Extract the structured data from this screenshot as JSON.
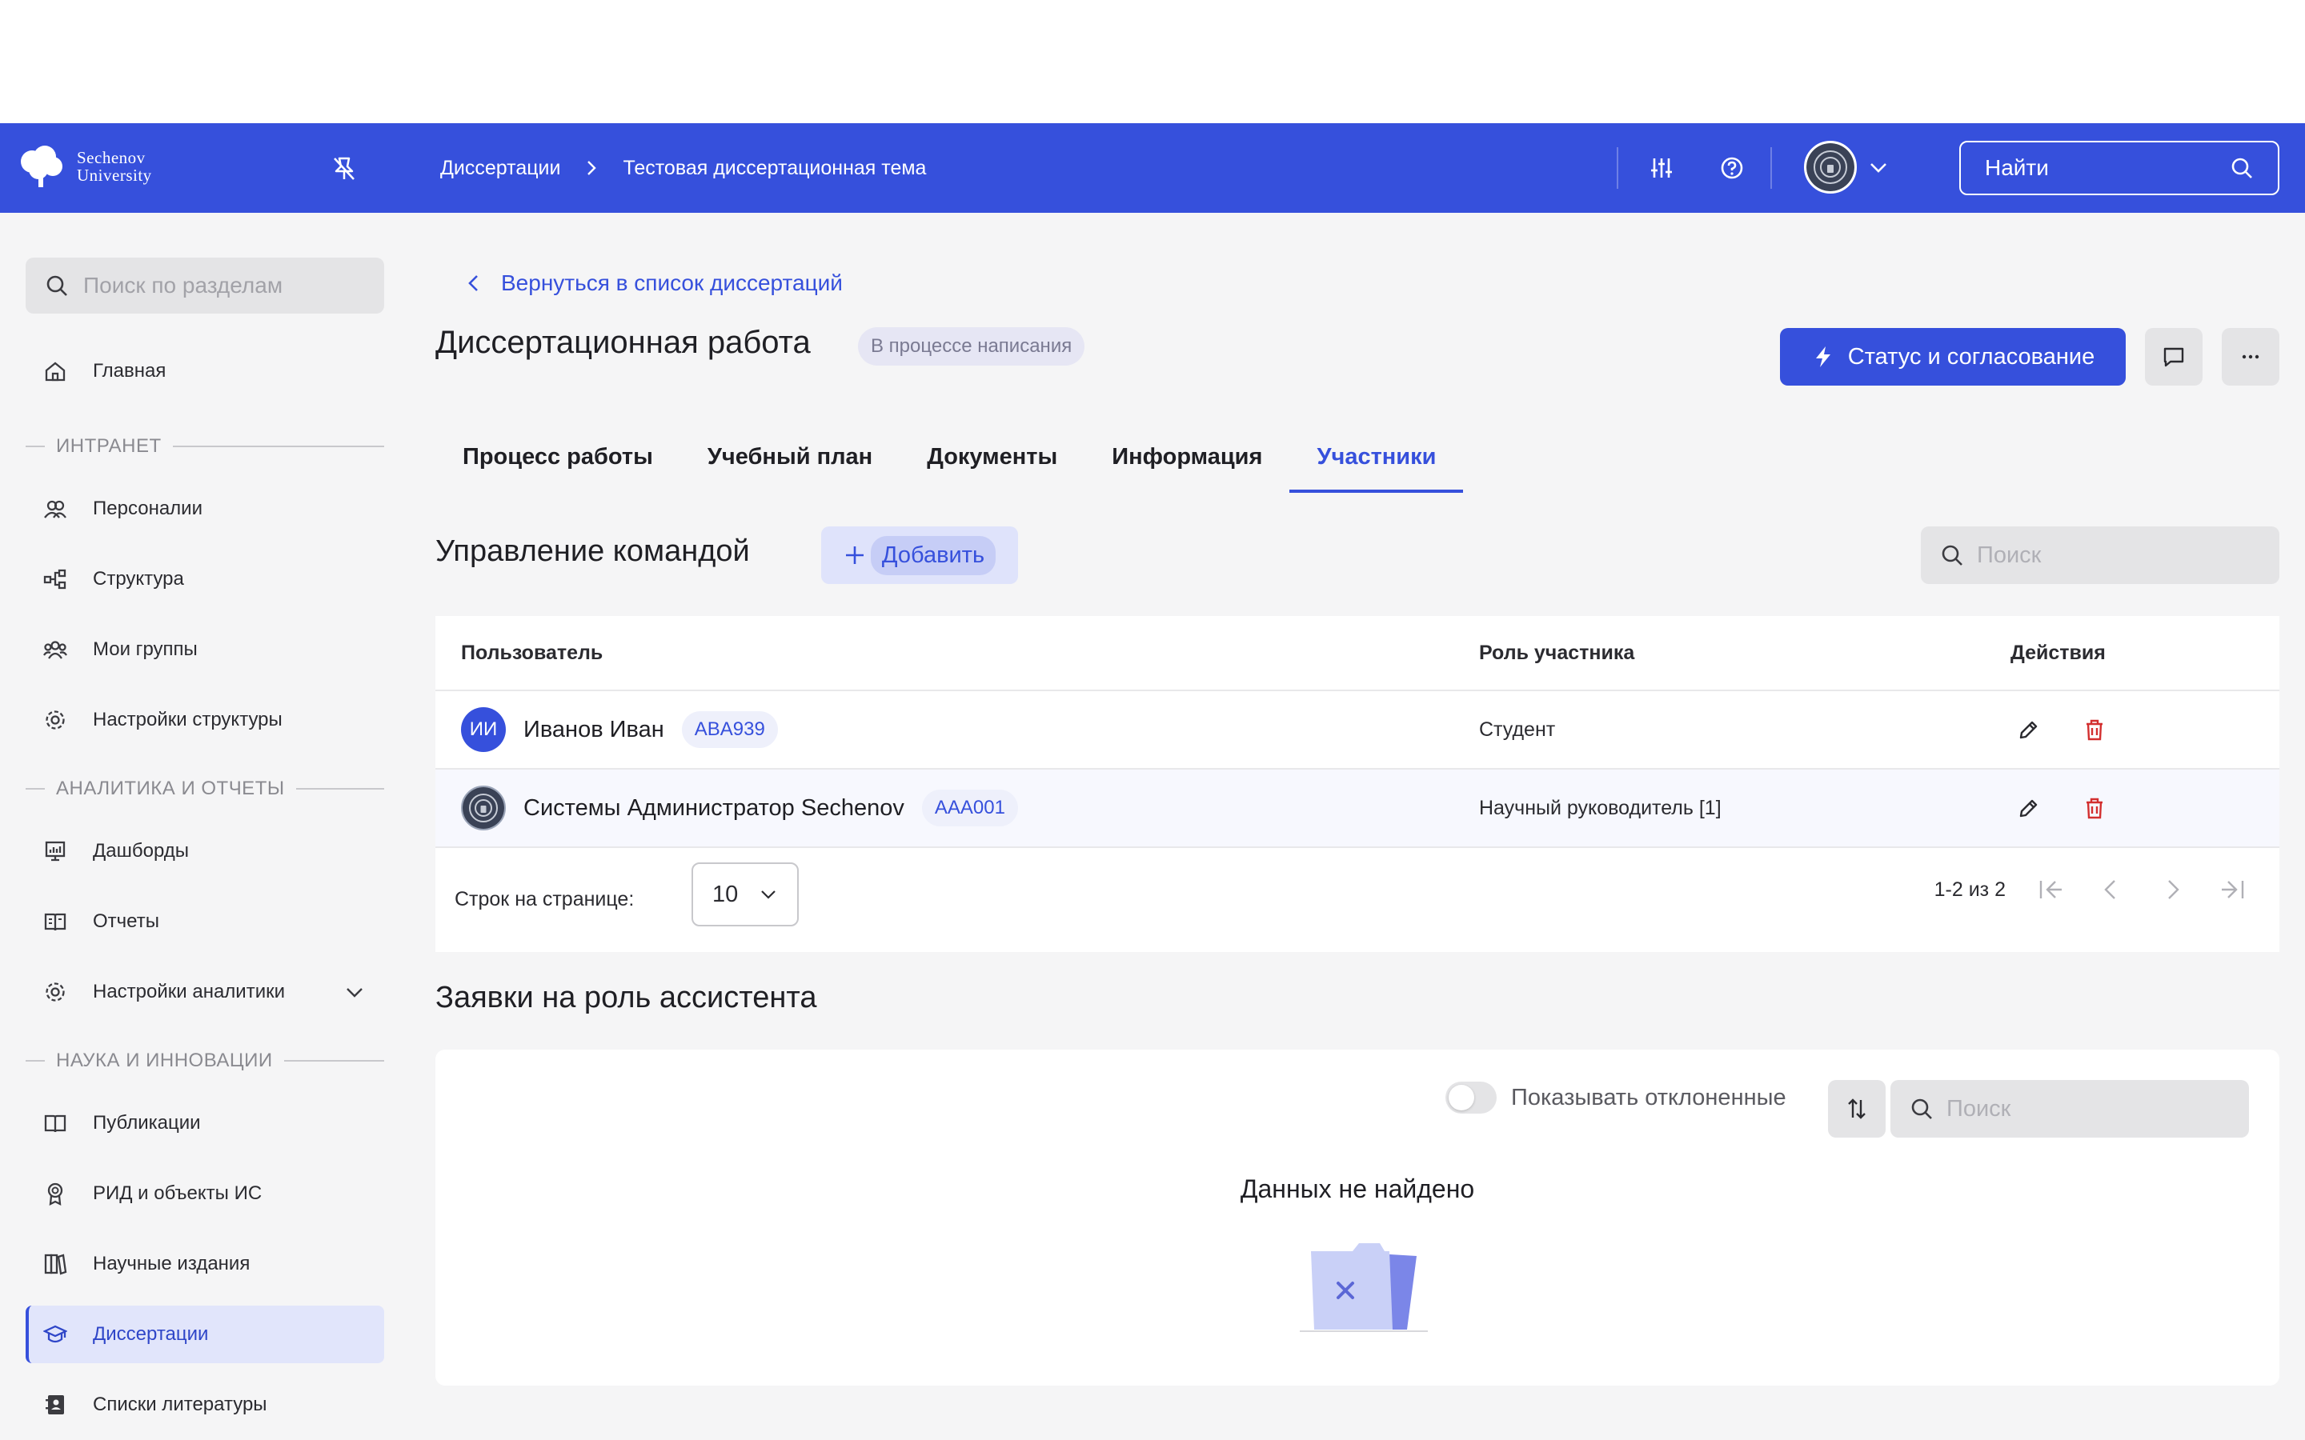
{
  "header": {
    "logo_line1": "Sechenov",
    "logo_line2": "University",
    "breadcrumbs": [
      "Диссертации",
      "Тестовая диссертационная тема"
    ],
    "search_label": "Найти"
  },
  "sidebar": {
    "search_placeholder": "Поиск по разделам",
    "home": "Главная",
    "sections": [
      {
        "title": "ИНТРАНЕТ",
        "items": [
          "Персоналии",
          "Структура",
          "Мои группы",
          "Настройки структуры"
        ]
      },
      {
        "title": "АНАЛИТИКА И ОТЧЕТЫ",
        "items": [
          "Дашборды",
          "Отчеты",
          "Настройки аналитики"
        ]
      },
      {
        "title": "НАУКА И ИННОВАЦИИ",
        "items": [
          "Публикации",
          "РИД и объекты ИС",
          "Научные издания",
          "Диссертации",
          "Списки литературы"
        ]
      }
    ],
    "active_item": "Диссертации"
  },
  "main": {
    "back_link": "Вернуться в список диссертаций",
    "title": "Диссертационная работа",
    "status_badge": "В процессе написания",
    "primary_button": "Статус и согласование",
    "tabs": [
      "Процесс работы",
      "Учебный план",
      "Документы",
      "Информация",
      "Участники"
    ],
    "active_tab": "Участники",
    "team": {
      "title": "Управление командой",
      "add_button": "Добавить",
      "search_placeholder": "Поиск",
      "columns": [
        "Пользователь",
        "Роль участника",
        "Действия"
      ],
      "rows": [
        {
          "initials": "ИИ",
          "name": "Иванов Иван",
          "code": "ABA939",
          "role": "Студент"
        },
        {
          "initials": "",
          "name": "Системы Администратор Sechenov",
          "code": "AAA001",
          "role": "Научный руководитель [1]"
        }
      ],
      "rows_per_page_label": "Строк на странице:",
      "rows_per_page_value": "10",
      "range": "1-2 из 2"
    },
    "assistants": {
      "title": "Заявки на роль ассистента",
      "toggle_label": "Показывать отклоненные",
      "search_placeholder": "Поиск",
      "empty_text": "Данных не найдено"
    }
  },
  "colors": {
    "brand": "#3650dc",
    "danger": "#d32f2f",
    "active_bg": "#e1e5fb"
  }
}
